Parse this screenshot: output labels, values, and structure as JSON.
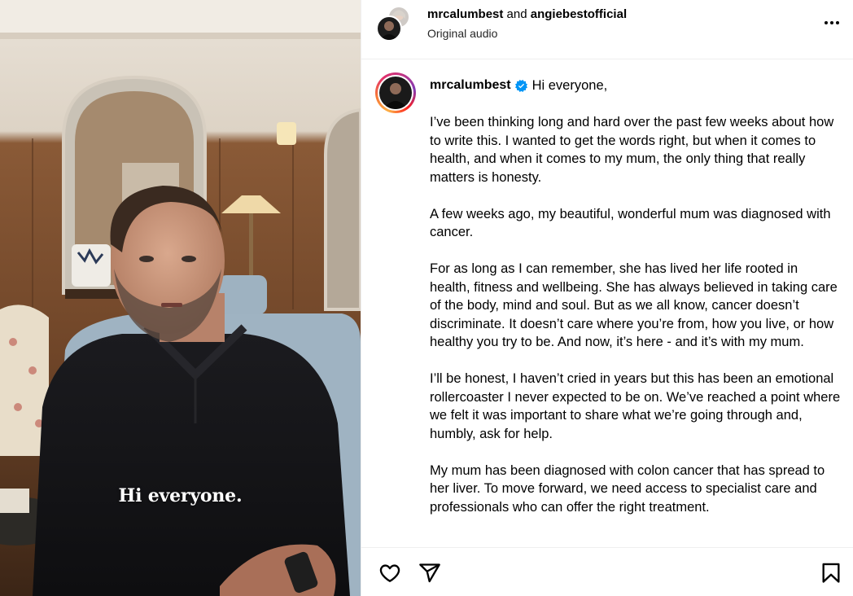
{
  "video": {
    "caption": "Hi everyone."
  },
  "header": {
    "author": "mrcalumbest",
    "joiner": "and",
    "collaborator": "angiebestofficial",
    "audio": "Original audio",
    "more_icon": "more-horizontal-icon"
  },
  "post": {
    "username": "mrcalumbest",
    "verified_icon": "verified-badge-icon",
    "greeting": "Hi everyone,",
    "paragraphs": [
      "I’ve been thinking long and hard over the past few weeks about how to write this. I wanted to get the words right, but when it comes to health, and when it comes to my mum, the only thing that really matters is honesty.",
      "A few weeks ago, my beautiful, wonderful mum was diagnosed with cancer.",
      "For as long as I can remember, she has lived her life rooted in health, fitness and wellbeing. She has always believed in taking care of the body, mind and soul. But as we all know, cancer doesn’t discriminate. It doesn’t care where you’re from, how you live, or how healthy you try to be. And now, it’s here - and it’s with my mum.",
      "I’ll be honest, I haven’t cried in years but this has been an emotional rollercoaster I never expected to be on. We’ve reached a point where we felt it was important to share what we’re going through and, humbly, ask for help.",
      "My mum has been diagnosed with colon cancer that has spread to her liver. To move forward, we need access to specialist care and professionals who can offer the right treatment."
    ]
  },
  "actions": {
    "like_icon": "heart-icon",
    "share_icon": "send-icon",
    "save_icon": "bookmark-icon"
  },
  "colors": {
    "verified": "#0095f6",
    "divider": "#efefef"
  }
}
